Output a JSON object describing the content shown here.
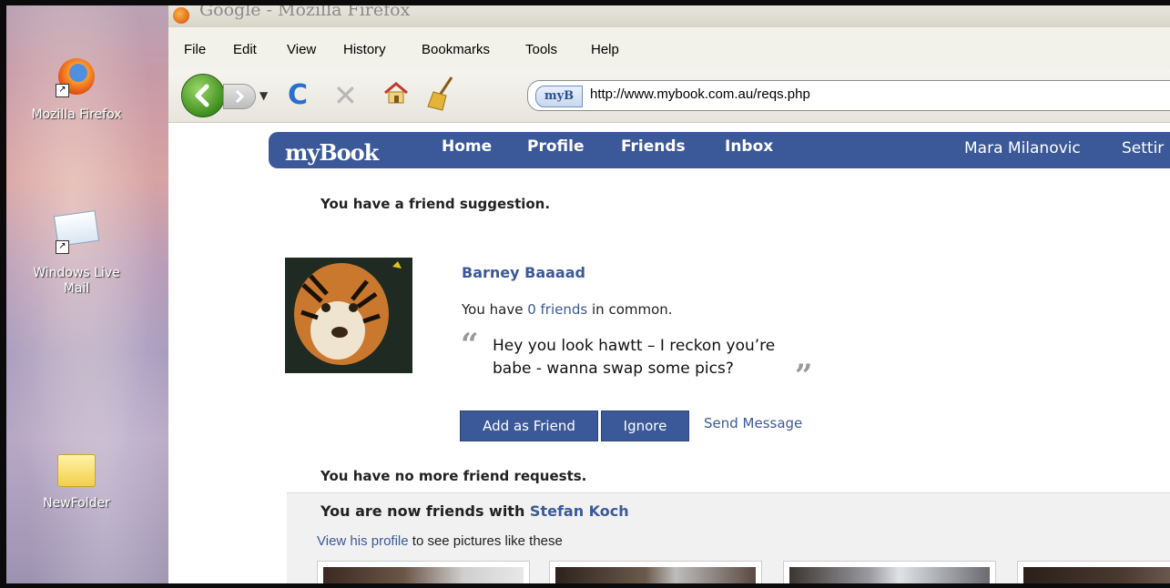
{
  "desktop": {
    "icons": [
      {
        "label": "Mozilla Firefox"
      },
      {
        "label_line1": "Windows Live",
        "label_line2": "Mail"
      },
      {
        "label": "NewFolder"
      }
    ]
  },
  "window": {
    "title": "Google - Mozilla Firefox"
  },
  "menu": {
    "items": [
      "File",
      "Edit",
      "View",
      "History",
      "Bookmarks",
      "Tools",
      "Help"
    ]
  },
  "toolbar": {
    "site_badge": "myB",
    "url": "http://www.mybook.com.au/reqs.php",
    "reload_glyph": "C",
    "stop_glyph": "✕"
  },
  "site": {
    "logo": "myBook",
    "nav": [
      "Home",
      "Profile",
      "Friends",
      "Inbox"
    ],
    "user_name": "Mara Milanovic",
    "settings_label": "Settir",
    "brand_color": "#3b5998"
  },
  "suggestion": {
    "heading": "You have a friend suggestion.",
    "name": "Barney Baaaad",
    "common_prefix": "You have",
    "common_link": "0 friends",
    "common_suffix": "in common.",
    "quote_line1": "Hey you look hawtt – I reckon you’re",
    "quote_line2": "babe - wanna swap some pics?",
    "add_button": "Add as Friend",
    "ignore_button": "Ignore",
    "send_message": "Send Message"
  },
  "requests": {
    "no_more": "You have no more friend requests."
  },
  "friends_now": {
    "prefix": "You are now friends with",
    "name": "Stefan Koch",
    "view_link": "View his profile",
    "view_suffix": "to see pictures like these"
  }
}
